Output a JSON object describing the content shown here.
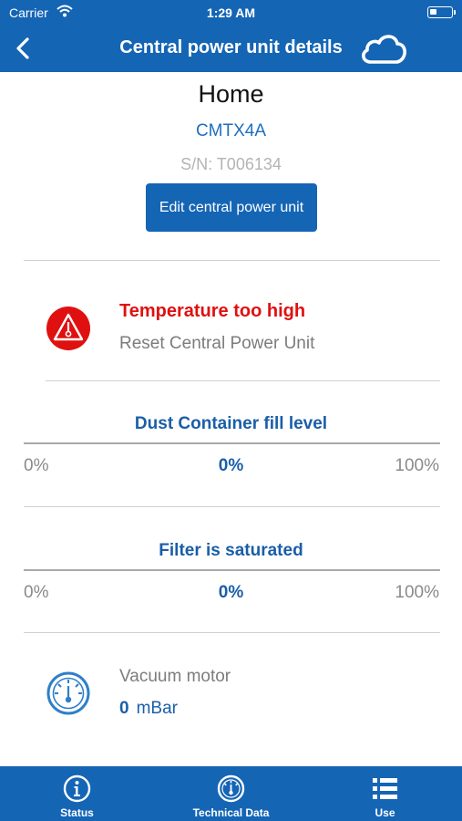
{
  "status_bar": {
    "carrier": "Carrier",
    "time": "1:29 AM",
    "battery_level": 0.35
  },
  "nav": {
    "title": "Central power unit details"
  },
  "unit": {
    "name": "Home",
    "model": "CMTX4A",
    "serial": "S/N: T006134",
    "edit_label": "Edit central power unit"
  },
  "warning": {
    "title": "Temperature too high",
    "subtitle": "Reset Central Power Unit",
    "color": "#e01010"
  },
  "dust": {
    "title": "Dust Container fill level",
    "min_label": "0%",
    "value_label": "0%",
    "max_label": "100%",
    "fill_level": 0
  },
  "filter": {
    "title": "Filter is saturated",
    "min_label": "0%",
    "value_label": "0%",
    "max_label": "100%",
    "fill_level": 0
  },
  "motor": {
    "label": "Vacuum motor",
    "value": "0",
    "unit": "mBar"
  },
  "tabs": [
    {
      "label": "Status",
      "icon": "info-icon"
    },
    {
      "label": "Technical Data",
      "icon": "gauge-icon"
    },
    {
      "label": "Use",
      "icon": "list-icon"
    }
  ],
  "colors": {
    "primary": "#1565b5",
    "accent_text": "#1a5ea8",
    "alert": "#e01010"
  }
}
